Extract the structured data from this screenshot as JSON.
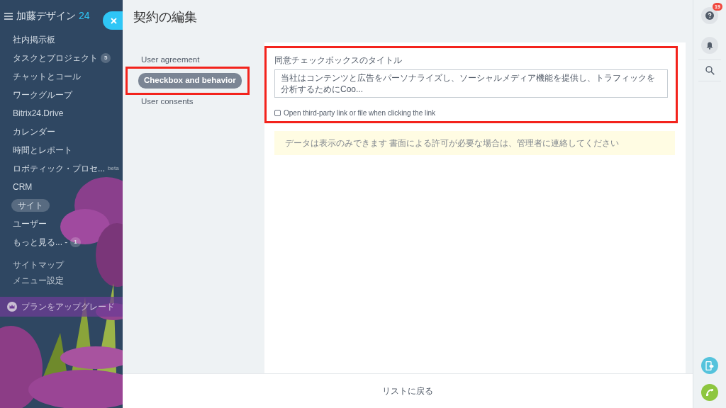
{
  "sidebar": {
    "title": "加藤デザイン",
    "logo_suffix": "24",
    "items": [
      {
        "label": "社内掲示板",
        "selected": false
      },
      {
        "label": "タスクとプロジェクト",
        "counter": "5",
        "selected": false
      },
      {
        "label": "チャットとコール",
        "selected": false
      },
      {
        "label": "ワークグループ",
        "selected": false
      },
      {
        "label": "Bitrix24.Drive",
        "selected": false
      },
      {
        "label": "カレンダー",
        "selected": false
      },
      {
        "label": "時間とレポート",
        "selected": false
      },
      {
        "label": "ロボティック・プロセ...",
        "tag": "beta",
        "selected": false
      },
      {
        "label": "CRM",
        "selected": false
      },
      {
        "label": "サイト",
        "selected": true
      },
      {
        "label": "ユーザー",
        "selected": false
      },
      {
        "label": "もっと見る... -",
        "counter": "1",
        "selected": false
      }
    ],
    "links": [
      "サイトマップ",
      "メニュー設定"
    ],
    "upgrade": "プランをアップグレード"
  },
  "page": {
    "title": "契約の編集",
    "nav": [
      {
        "label": "User agreement",
        "selected": false,
        "highlighted": false
      },
      {
        "label": "Checkbox and behavior",
        "selected": true,
        "highlighted": true
      },
      {
        "label": "User consents",
        "selected": false,
        "highlighted": false
      }
    ],
    "form": {
      "highlighted": true,
      "field_label": "同意チェックボックスのタイトル",
      "field_value": "当社はコンテンツと広告をパーソナライズし、ソーシャルメディア機能を提供し、トラフィックを分析するためにCoo...",
      "checkbox": {
        "label": "Open third-party link or file when clicking the link",
        "checked": false
      }
    },
    "notice": "データは表示のみできます 書面による許可が必要な場合は、管理者に連絡してください",
    "footer_link": "リストに戻る"
  },
  "right_bar": {
    "help_badge": "19"
  }
}
